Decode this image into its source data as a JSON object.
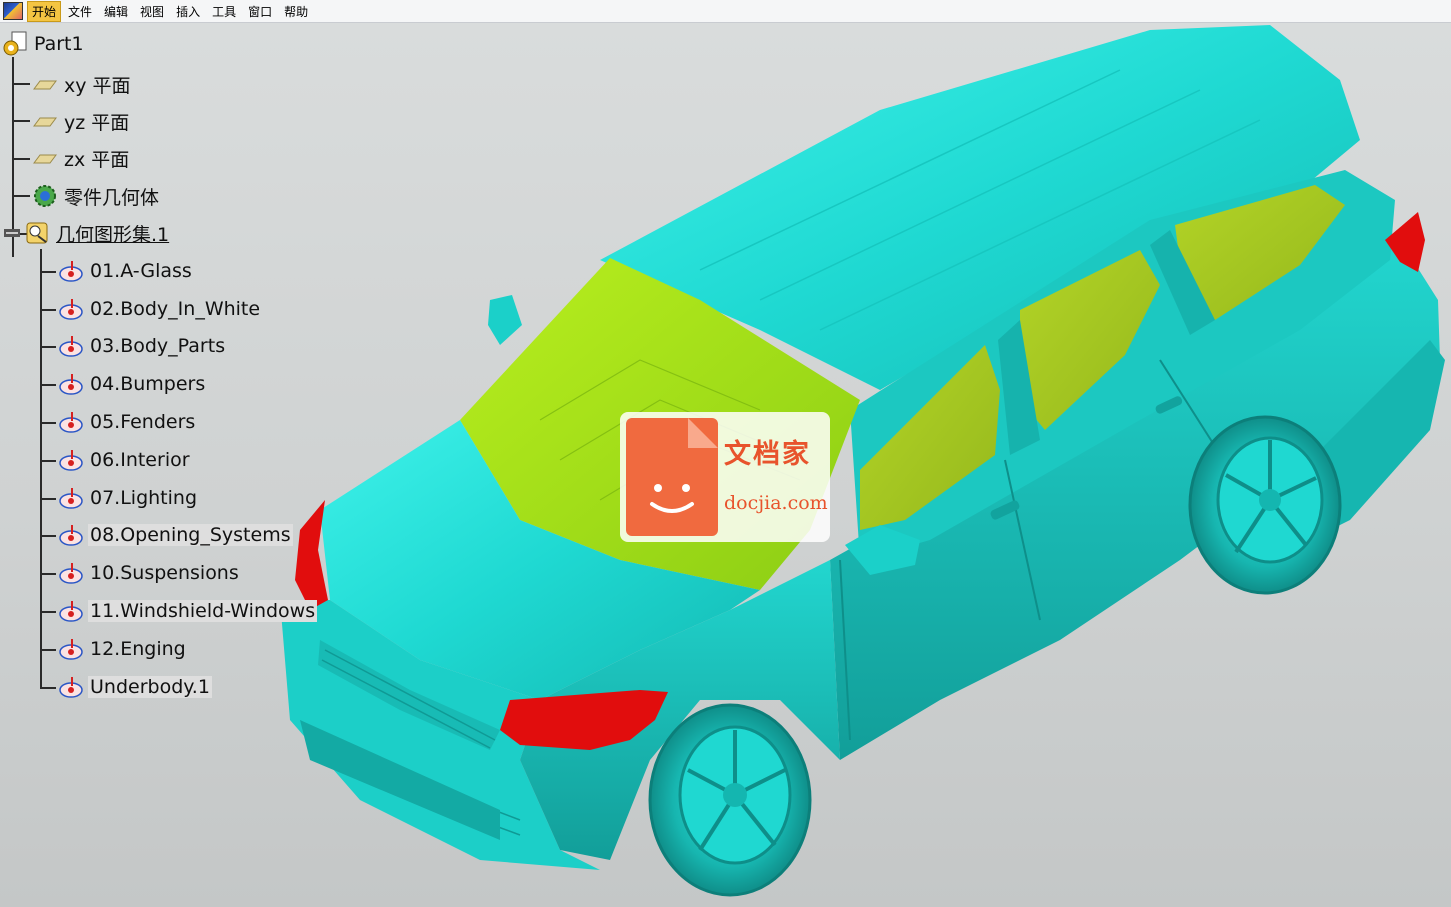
{
  "menu": {
    "items": [
      {
        "label": "开始",
        "active": true
      },
      {
        "label": "文件"
      },
      {
        "label": "编辑"
      },
      {
        "label": "视图"
      },
      {
        "label": "插入"
      },
      {
        "label": "工具"
      },
      {
        "label": "窗口"
      },
      {
        "label": "帮助"
      }
    ]
  },
  "tree": {
    "root": "Part1",
    "planes": [
      "xy 平面",
      "yz 平面",
      "zx 平面"
    ],
    "part_body": "零件几何体",
    "geo_set": "几何图形集.1",
    "children": [
      "01.A-Glass",
      "02.Body_In_White",
      "03.Body_Parts",
      "04.Bumpers",
      "05.Fenders",
      "06.Interior",
      "07.Lighting",
      "08.Opening_Systems",
      "10.Suspensions",
      "11.Windshield-Windows",
      "12.Enging",
      "Underbody.1"
    ]
  },
  "watermark": {
    "title": "文档家",
    "domain": "docjia.com"
  },
  "colors": {
    "body": "#1fe3dc",
    "glass": "#a6e21a",
    "lights": "#e10d0d",
    "background": "#d4d7d7",
    "menubar_active": "#f4c542"
  }
}
